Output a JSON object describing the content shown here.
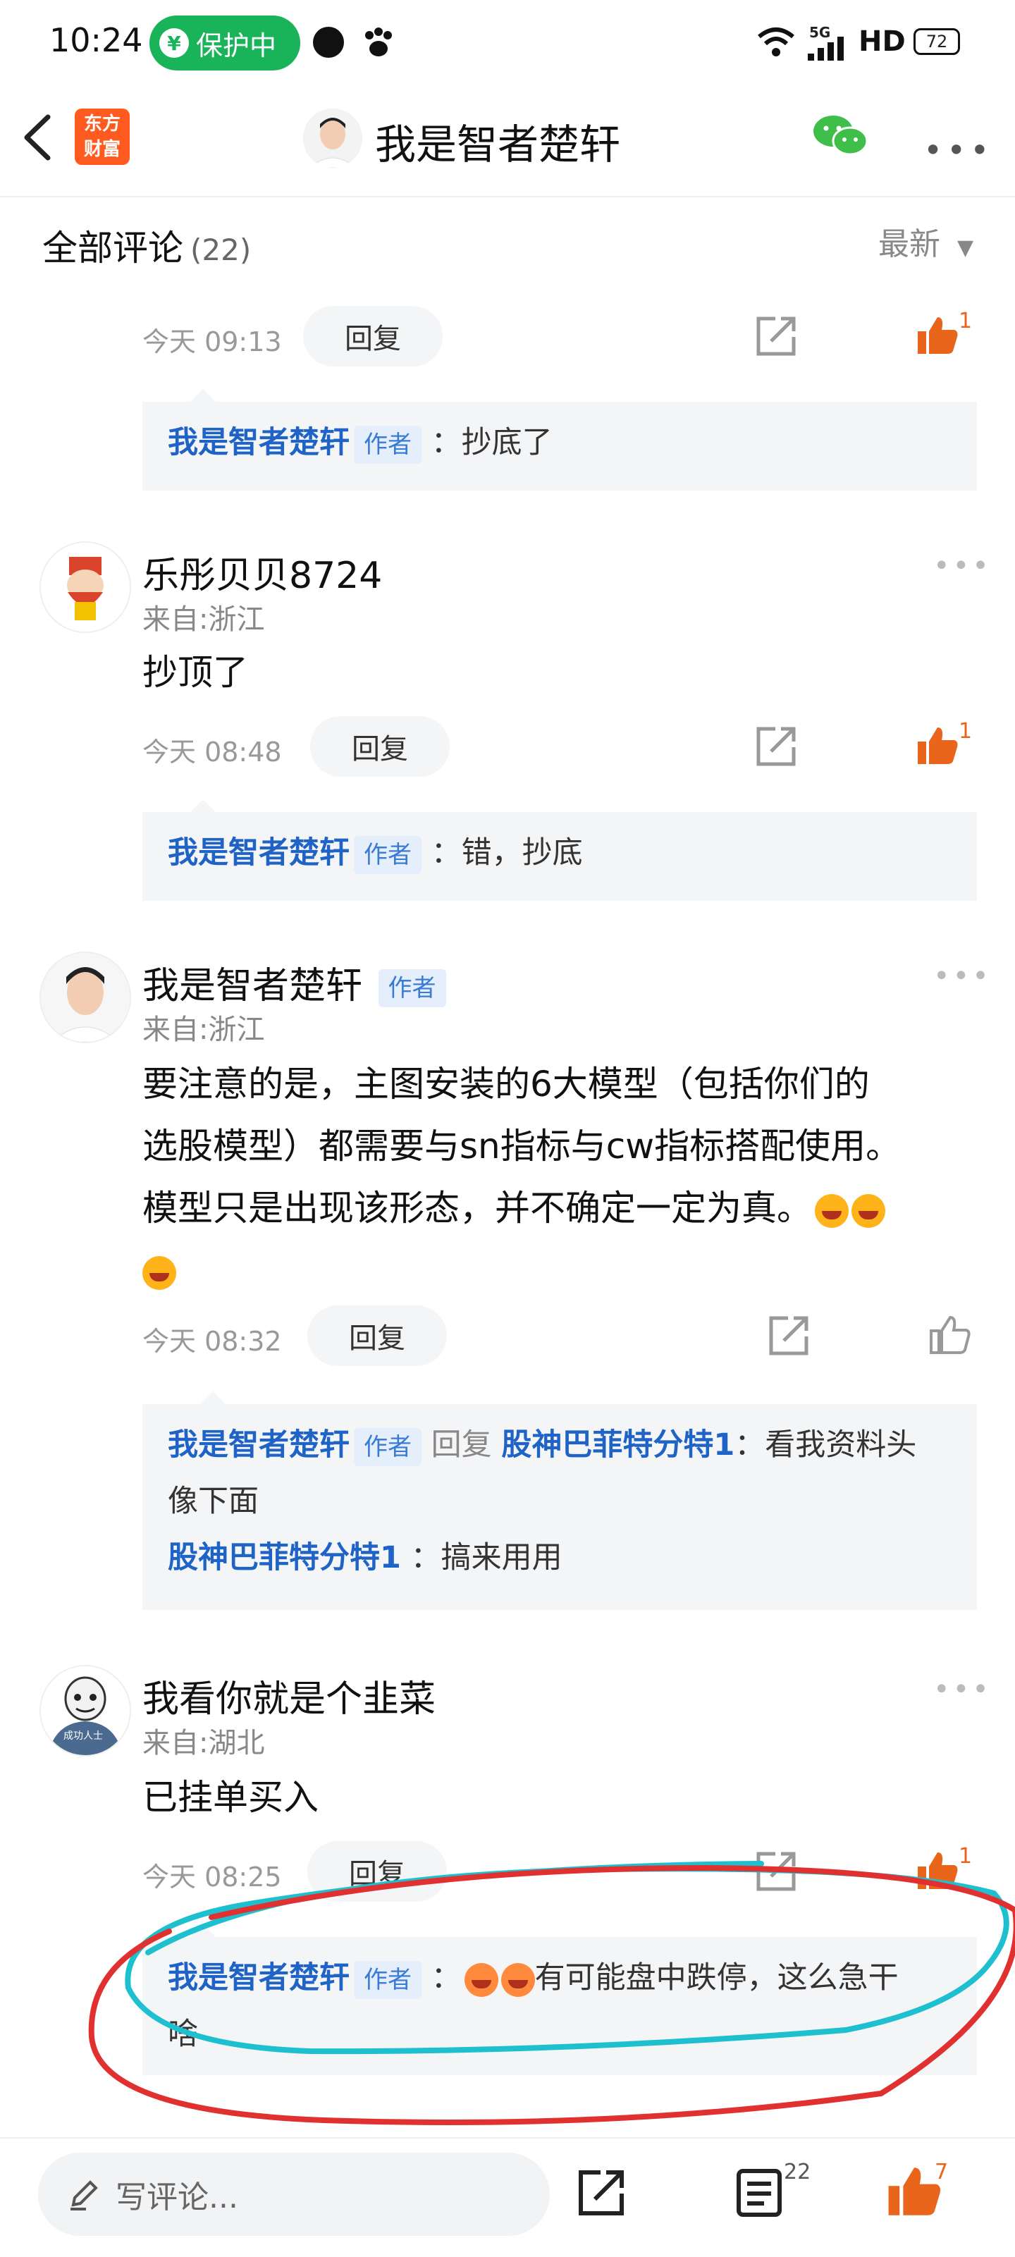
{
  "status_bar": {
    "time": "10:24",
    "protect_label": "保护中",
    "network": "5G",
    "hd": "HD",
    "battery": "72"
  },
  "header": {
    "app_logo_line1": "东方",
    "app_logo_line2": "财富",
    "title": "我是智者楚轩"
  },
  "comments_section": {
    "title": "全部评论",
    "count": "(22)",
    "sort_label": "最新"
  },
  "comments": [
    {
      "time": "今天 09:13",
      "reply_label": "回复",
      "like_count": "1",
      "replies": [
        {
          "author": "我是智者楚轩",
          "tag": "作者",
          "text": "：抄底了"
        }
      ]
    },
    {
      "name": "乐彤贝贝8724",
      "from": "来自:浙江",
      "text": "抄顶了",
      "time": "今天 08:48",
      "reply_label": "回复",
      "like_count": "1",
      "replies": [
        {
          "author": "我是智者楚轩",
          "tag": "作者",
          "text": "：错，抄底"
        }
      ]
    },
    {
      "name": "我是智者楚轩",
      "tag": "作者",
      "from": "来自:浙江",
      "text_line1": "要注意的是，主图安装的6大模型（包括你们的",
      "text_line2": "选股模型）都需要与sn指标与cw指标搭配使用。",
      "text_line3": "模型只是出现该形态，并不确定一定为真。",
      "time": "今天 08:32",
      "reply_label": "回复",
      "replies": [
        {
          "author": "我是智者楚轩",
          "tag": "作者",
          "reply_word": "回复",
          "target": "股神巴菲特分特1",
          "text_line1": "：看我资料头",
          "text_line2": "像下面"
        },
        {
          "author": "股神巴菲特分特1",
          "text": "：搞来用用"
        }
      ]
    },
    {
      "name": "我看你就是个韭菜",
      "from": "来自:湖北",
      "text": "已挂单买入",
      "time": "今天 08:25",
      "reply_label": "回复",
      "like_count": "1",
      "avatar_caption": "成功人士",
      "replies": [
        {
          "author": "我是智者楚轩",
          "tag": "作者",
          "text_line1": "有可能盘中跌停，这么急干",
          "text_line2": "啥"
        }
      ]
    }
  ],
  "bottom_bar": {
    "input_placeholder": "写评论...",
    "comment_count": "22",
    "like_count": "7"
  },
  "colors": {
    "accent_orange": "#e8651b",
    "author_blue": "#1e63c5",
    "protect_green": "#19b35a",
    "annotation_red": "#e03030",
    "annotation_cyan": "#1ec0d0"
  }
}
